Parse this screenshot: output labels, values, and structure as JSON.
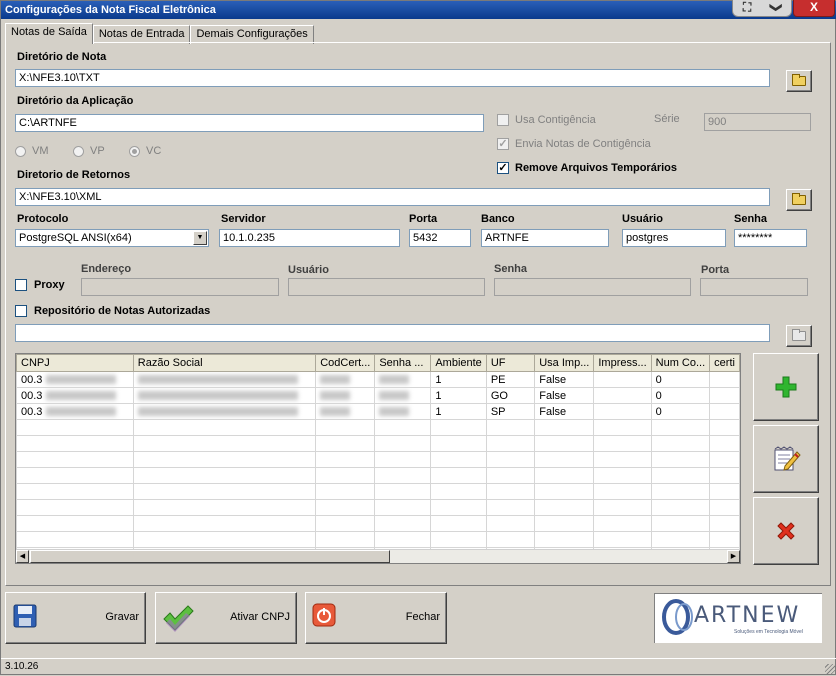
{
  "window": {
    "title": "Configurações da Nota Fiscal Eletrônica",
    "close_label": "X",
    "btn1_glyph": "⛶",
    "btn2_glyph": "❯"
  },
  "tabs": [
    {
      "label": "Notas de Saída",
      "active": true
    },
    {
      "label": "Notas de Entrada",
      "active": false
    },
    {
      "label": "Demais Configurações",
      "active": false
    }
  ],
  "form": {
    "dir_nota_label": "Diretório de Nota",
    "dir_nota_value": "X:\\NFE3.10\\TXT",
    "dir_app_label": "Diretório da Aplicação",
    "dir_app_value": "C:\\ARTNFE",
    "usa_contingencia_label": "Usa Contigência",
    "serie_label": "Série",
    "serie_value": "900",
    "envia_notas_label": "Envia Notas de Contigência",
    "remove_temp_label": "Remove Arquivos Temporários",
    "radios": [
      {
        "label": "VM",
        "checked": false
      },
      {
        "label": "VP",
        "checked": false
      },
      {
        "label": "VC",
        "checked": true
      }
    ],
    "dir_retornos_label": "Diretorio de Retornos",
    "dir_retornos_value": "X:\\NFE3.10\\XML",
    "protocolo_label": "Protocolo",
    "protocolo_value": "PostgreSQL ANSI(x64)",
    "servidor_label": "Servidor",
    "servidor_value": "10.1.0.235",
    "porta_label": "Porta",
    "porta_value": "5432",
    "banco_label": "Banco",
    "banco_value": "ARTNFE",
    "usuario_label": "Usuário",
    "usuario_value": "postgres",
    "senha_label": "Senha",
    "senha_value": "********",
    "proxy_label": "Proxy",
    "endereco_label": "Endereço",
    "proxy_usuario_label": "Usuário",
    "proxy_senha_label": "Senha",
    "proxy_porta_label": "Porta",
    "repositorio_label": "Repositório de Notas Autorizadas",
    "repositorio_value": ""
  },
  "grid": {
    "columns": [
      "CNPJ",
      "Razão Social",
      "CodCert...",
      "Senha ...",
      "Ambiente",
      "UF",
      "Usa Imp...",
      "Impress...",
      "Num Co...",
      "certi"
    ],
    "rows": [
      {
        "cnpj": "00.3",
        "ambiente": "1",
        "uf": "PE",
        "usa_imp": "False",
        "num_co": "0"
      },
      {
        "cnpj": "00.3",
        "ambiente": "1",
        "uf": "GO",
        "usa_imp": "False",
        "num_co": "0"
      },
      {
        "cnpj": "00.3",
        "ambiente": "1",
        "uf": "SP",
        "usa_imp": "False",
        "num_co": "0"
      }
    ]
  },
  "side_buttons": {
    "add_icon": "plus-icon",
    "edit_icon": "edit-icon",
    "delete_icon": "delete-icon"
  },
  "footer": {
    "gravar_label": "Gravar",
    "ativar_label": "Ativar CNPJ",
    "fechar_label": "Fechar",
    "logo_text": "ARTNEW",
    "logo_tagline": "Soluções em Tecnologia Móvel"
  },
  "status": {
    "version": "3.10.26"
  },
  "colors": {
    "title_bar": "#0a3a8c",
    "close_btn": "#c62e2e",
    "plus": "#2fb52f",
    "delete": "#e0301e"
  }
}
